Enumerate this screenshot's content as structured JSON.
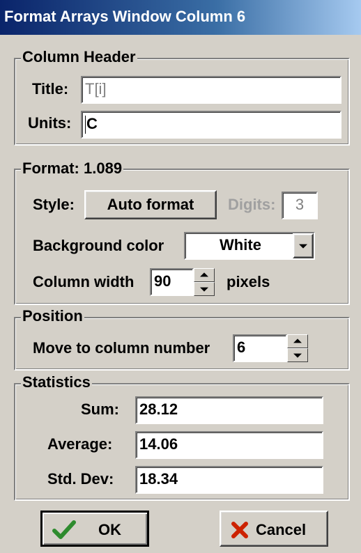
{
  "window": {
    "title": "Format Arrays Window Column 6"
  },
  "column_header": {
    "legend": "Column Header",
    "title_label": "Title:",
    "title_value": "T[i]",
    "units_label": "Units:",
    "units_value": "C"
  },
  "format": {
    "legend": "Format: 1.089",
    "style_label": "Style:",
    "style_value": "Auto format",
    "digits_label": "Digits:",
    "digits_value": "3",
    "background_label": "Background color",
    "background_value": "White",
    "width_label": "Column width",
    "width_value": "90",
    "width_unit": "pixels"
  },
  "position": {
    "legend": "Position",
    "move_label": "Move to column number",
    "move_value": "6"
  },
  "statistics": {
    "legend": "Statistics",
    "sum_label": "Sum:",
    "sum_value": "28.12",
    "average_label": "Average:",
    "average_value": "14.06",
    "stddev_label": "Std. Dev:",
    "stddev_value": "18.34"
  },
  "buttons": {
    "ok_label": "OK",
    "cancel_label": "Cancel"
  },
  "icons": {
    "ok": "checkmark-icon",
    "cancel": "x-icon"
  },
  "colors": {
    "titlebar": "#0a246a",
    "face": "#d4d0c8",
    "ok_check": "#2e8b2e",
    "cancel_x": "#cc2200"
  }
}
